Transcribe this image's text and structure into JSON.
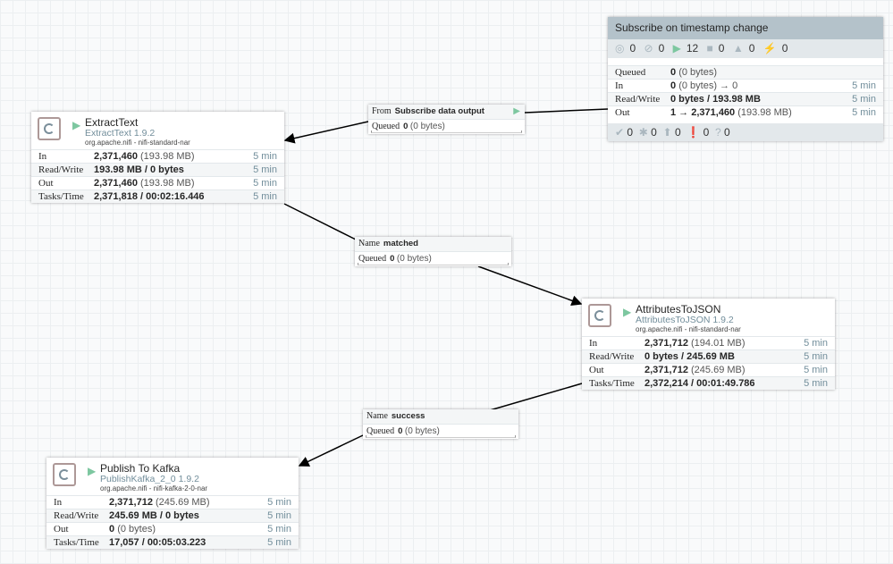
{
  "process_group": {
    "name": "Subscribe on timestamp change",
    "status": [
      {
        "icon": "transmitting-icon",
        "value": "0"
      },
      {
        "icon": "not-transmitting-icon",
        "value": "0"
      },
      {
        "icon": "running-icon",
        "value": "12"
      },
      {
        "icon": "stopped-icon",
        "value": "0"
      },
      {
        "icon": "invalid-icon",
        "value": "0"
      },
      {
        "icon": "disabled-icon",
        "value": "0"
      }
    ],
    "stats": [
      {
        "label": "Queued",
        "value": "0",
        "detail": "(0 bytes)",
        "time": ""
      },
      {
        "label": "In",
        "value": "0",
        "detail": "(0 bytes) → 0",
        "time": "5 min"
      },
      {
        "label": "Read/Write",
        "value": "0 bytes / 193.98 MB",
        "detail": "",
        "time": "5 min"
      },
      {
        "label": "Out",
        "value": "1 → 2,371,460",
        "detail": "(193.98 MB)",
        "time": "5 min"
      }
    ],
    "footer": [
      {
        "icon": "up-to-date-icon",
        "value": "0"
      },
      {
        "icon": "locally-modified-icon",
        "value": "0"
      },
      {
        "icon": "stale-icon",
        "value": "0"
      },
      {
        "icon": "modified-stale-icon",
        "value": "0"
      },
      {
        "icon": "sync-failure-icon",
        "value": "0"
      }
    ]
  },
  "processors": [
    {
      "name": "ExtractText",
      "type": "ExtractText 1.9.2",
      "bundle": "org.apache.nifi - nifi-standard-nar",
      "stats": [
        {
          "label": "In",
          "value": "2,371,460",
          "detail": "(193.98 MB)",
          "time": "5 min"
        },
        {
          "label": "Read/Write",
          "value": "193.98 MB / 0 bytes",
          "detail": "",
          "time": "5 min"
        },
        {
          "label": "Out",
          "value": "2,371,460",
          "detail": "(193.98 MB)",
          "time": "5 min"
        },
        {
          "label": "Tasks/Time",
          "value": "2,371,818 / 00:02:16.446",
          "detail": "",
          "time": "5 min"
        }
      ]
    },
    {
      "name": "AttributesToJSON",
      "type": "AttributesToJSON 1.9.2",
      "bundle": "org.apache.nifi - nifi-standard-nar",
      "stats": [
        {
          "label": "In",
          "value": "2,371,712",
          "detail": "(194.01 MB)",
          "time": "5 min"
        },
        {
          "label": "Read/Write",
          "value": "0 bytes / 245.69 MB",
          "detail": "",
          "time": "5 min"
        },
        {
          "label": "Out",
          "value": "2,371,712",
          "detail": "(245.69 MB)",
          "time": "5 min"
        },
        {
          "label": "Tasks/Time",
          "value": "2,372,214 / 00:01:49.786",
          "detail": "",
          "time": "5 min"
        }
      ]
    },
    {
      "name": "Publish To Kafka",
      "type": "PublishKafka_2_0 1.9.2",
      "bundle": "org.apache.nifi - nifi-kafka-2-0-nar",
      "stats": [
        {
          "label": "In",
          "value": "2,371,712",
          "detail": "(245.69 MB)",
          "time": "5 min"
        },
        {
          "label": "Read/Write",
          "value": "245.69 MB / 0 bytes",
          "detail": "",
          "time": "5 min"
        },
        {
          "label": "Out",
          "value": "0",
          "detail": "(0 bytes)",
          "time": "5 min"
        },
        {
          "label": "Tasks/Time",
          "value": "17,057 / 00:05:03.223",
          "detail": "",
          "time": "5 min"
        }
      ]
    }
  ],
  "connections": [
    {
      "label": "From",
      "name": "Subscribe data output",
      "queued_label": "Queued",
      "queued": "0",
      "queued_detail": "(0 bytes)"
    },
    {
      "label": "Name",
      "name": "matched",
      "queued_label": "Queued",
      "queued": "0",
      "queued_detail": "(0 bytes)"
    },
    {
      "label": "Name",
      "name": "success",
      "queued_label": "Queued",
      "queued": "0",
      "queued_detail": "(0 bytes)"
    }
  ]
}
